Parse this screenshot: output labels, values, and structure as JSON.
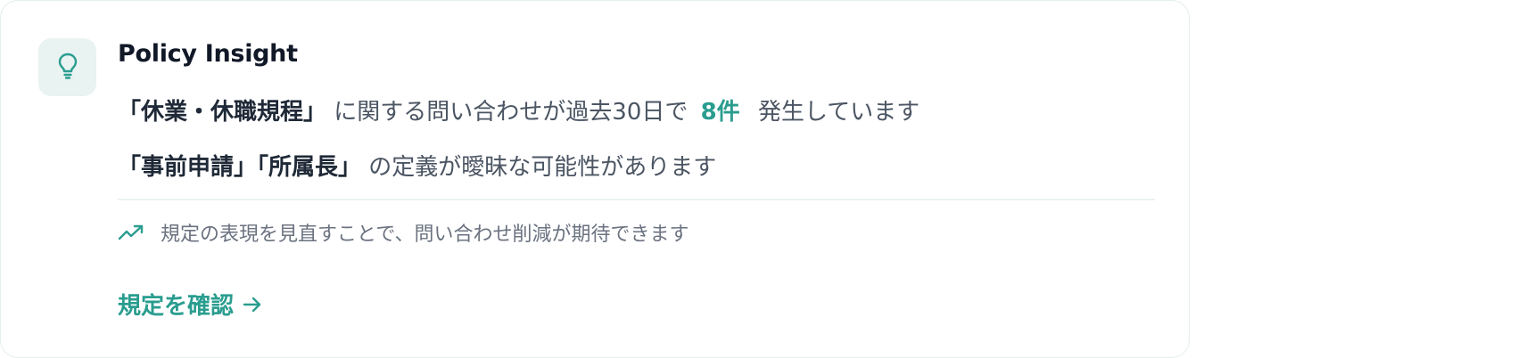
{
  "card": {
    "title": "Policy Insight",
    "message": {
      "policy_name": "「休業・休職規程」",
      "prefix_text": "に関する問い合わせが過去30日で",
      "count": "8件",
      "suffix_text": "発生しています"
    },
    "ambiguity": {
      "terms": "「事前申請」「所属長」",
      "text": "の定義が曖昧な可能性があります"
    },
    "tip": {
      "icon": "trending-up-icon",
      "text": "規定の表現を見直すことで、問い合わせ削減が期待できます"
    },
    "action": {
      "label": "規定を確認",
      "icon": "arrow-right-icon"
    },
    "header_icon": "lightbulb-icon"
  },
  "colors": {
    "accent": "#2a9d8f",
    "icon_tile_bg": "#e8f3f2",
    "title": "#111827",
    "body_text": "#4b5563",
    "muted_text": "#6b7280",
    "border": "#e4eeec"
  }
}
